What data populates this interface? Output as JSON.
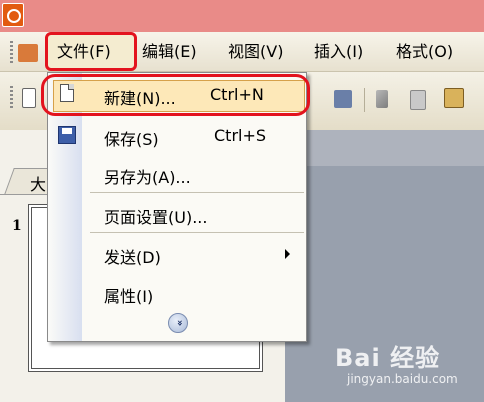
{
  "menubar": {
    "items": [
      {
        "label": "文件(F)"
      },
      {
        "label": "编辑(E)"
      },
      {
        "label": "视图(V)"
      },
      {
        "label": "插入(I)"
      },
      {
        "label": "格式(O)"
      }
    ]
  },
  "dropdown": {
    "items": [
      {
        "label": "新建(N)...",
        "shortcut": "Ctrl+N",
        "icon": "new-document-icon"
      },
      {
        "label": "保存(S)",
        "shortcut": "Ctrl+S",
        "icon": "save-icon"
      },
      {
        "label": "另存为(A)..."
      },
      {
        "label": "页面设置(U)..."
      },
      {
        "label": "发送(D)",
        "submenu": true
      },
      {
        "label": "属性(I)"
      }
    ],
    "expand_glyph": "»"
  },
  "panel": {
    "tab_label": "大",
    "slide_number": "1"
  },
  "watermark": {
    "brand": "Bai 经验",
    "url": "jingyan.baidu.com"
  },
  "colors": {
    "highlight_border": "#e3131e",
    "hover": "#fde8b8",
    "title_bar": "#e98b88"
  }
}
